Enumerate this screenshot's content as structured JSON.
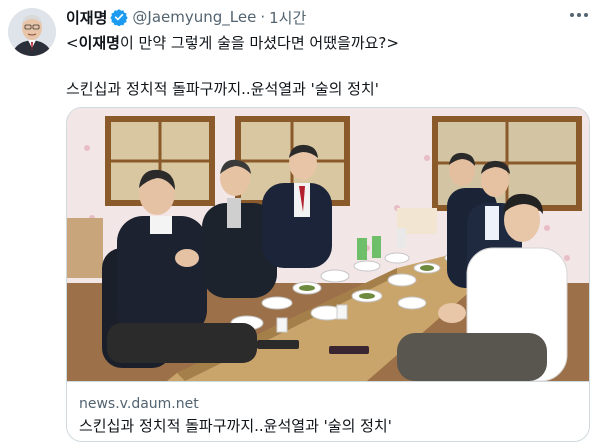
{
  "tweet": {
    "display_name": "이재명",
    "handle": "@Jaemyung_Lee",
    "separator": "·",
    "time": "1시간",
    "line1_prefix": "<",
    "line1_bold": "이재명",
    "line1_rest": "이 만약 그렇게 술을 마셨다면 어땠을까요?>",
    "line2": "스킨십과 정치적 돌파구까지..윤석열과 '술의 정치'"
  },
  "card": {
    "domain": "news.v.daum.net",
    "title": "스킨십과 정치적 돌파구까지..윤석열과 '술의 정치'"
  },
  "icons": {
    "verified": "verified-badge-icon",
    "more": "more-options-icon"
  },
  "colors": {
    "verified_blue": "#1d9bf0",
    "secondary_text": "#536471",
    "border": "#cfd9de"
  }
}
